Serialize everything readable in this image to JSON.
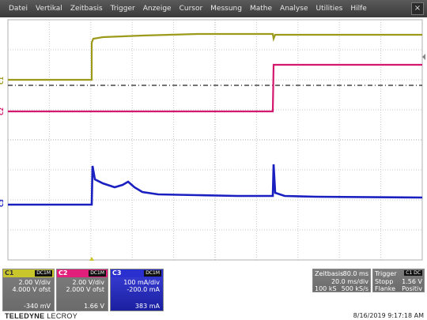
{
  "menu": {
    "items": [
      "Datei",
      "Vertikal",
      "Zeitbasis",
      "Trigger",
      "Anzeige",
      "Cursor",
      "Messung",
      "Mathe",
      "Analyse",
      "Utilities",
      "Hilfe"
    ],
    "close_label": "×"
  },
  "traces": {
    "c1": {
      "label": "C1",
      "color": "#9c9a1a"
    },
    "c2": {
      "label": "C2",
      "color": "#d4186e"
    },
    "c3": {
      "label": "C3",
      "color": "#1a1fc0"
    }
  },
  "channels": {
    "c1": {
      "tag": "C1",
      "coupling": "DC1M",
      "scale": "2.00 V/div",
      "offset": "4.000 V ofst",
      "value": "-340 mV",
      "color": "#c8c62a"
    },
    "c2": {
      "tag": "C2",
      "coupling": "DC1M",
      "scale": "2.00 V/div",
      "offset": "2.000 V ofst",
      "value": "1.66 V",
      "color": "#e0207a"
    },
    "c3": {
      "tag": "C3",
      "coupling": "DC1M",
      "scale": "100 mA/div",
      "offset": "-200.0 mA",
      "value": "383 mA",
      "color": "#2a2fd0"
    }
  },
  "timebase": {
    "title": "Zeitbasis",
    "delay": "-80.0 ms",
    "per_div": "20.0 ms/div",
    "samples": "100 kS",
    "rate": "500 kS/s"
  },
  "trigger": {
    "title": "Trigger",
    "source": "C1 DC",
    "mode": "Stopp",
    "level": "1.56 V",
    "type": "Flanke",
    "slope": "Positiv"
  },
  "brand": {
    "name_bold": "TELEDYNE",
    "name_rest": " LECROY"
  },
  "datetime": "8/16/2019 9:17:18 AM"
}
